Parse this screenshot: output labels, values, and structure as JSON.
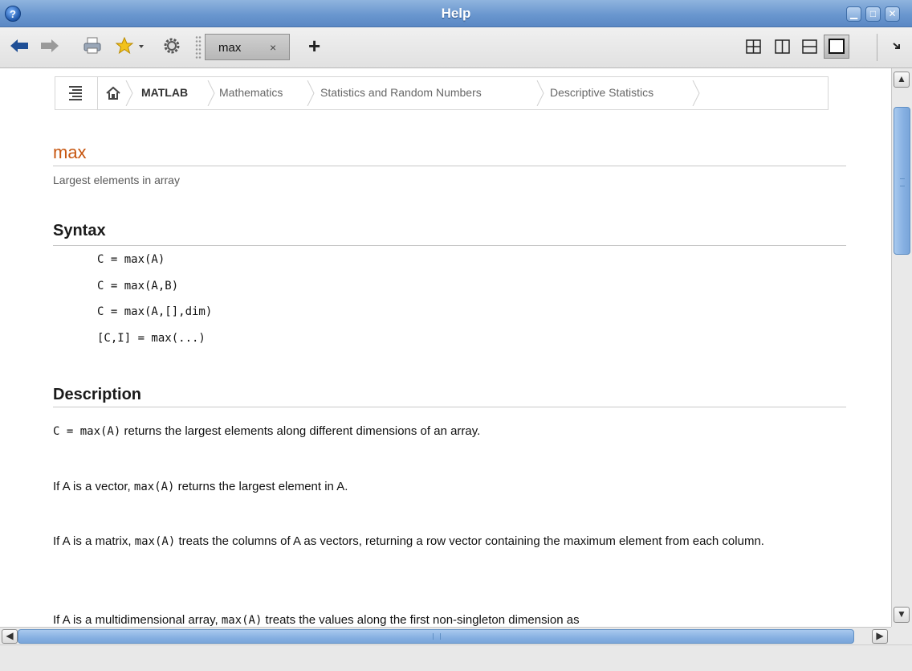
{
  "window": {
    "title": "Help",
    "app_icon": "help-icon",
    "controls": [
      "minimize-icon",
      "maximize-icon",
      "close-icon"
    ]
  },
  "toolbar": {
    "buttons": [
      "back-arrow-icon",
      "forward-arrow-icon",
      "print-icon",
      "favorites-star-icon",
      "settings-gear-icon"
    ],
    "tab": {
      "label": "max",
      "close": "×"
    },
    "add_tab": "+",
    "layout_buttons": [
      "grid-layout-icon",
      "vertical-split-icon",
      "horizontal-split-icon",
      "single-pane-icon"
    ],
    "active_layout": "single-pane-icon"
  },
  "breadcrumb": {
    "items": [
      "MATLAB",
      "Mathematics",
      "Statistics and Random Numbers",
      "Descriptive Statistics"
    ]
  },
  "page": {
    "function_name": "max",
    "purpose": "Largest elements in array",
    "syntax_heading": "Syntax",
    "syntax": [
      "C = max(A)",
      "C = max(A,B)",
      "C = max(A,[],dim)",
      "[C,I] = max(...)"
    ],
    "description_heading": "Description",
    "paragraphs": [
      {
        "code": "C = max(A)",
        "text": " returns the largest elements along different dimensions of an array."
      },
      {
        "pre": "If A is a vector, ",
        "code": "max(A)",
        "text": " returns the largest element in A."
      },
      {
        "pre": "If A is a matrix, ",
        "code": "max(A)",
        "text": " treats the columns of A as vectors, returning a row vector containing the maximum element from each column."
      },
      {
        "pre": "If A is a multidimensional array, ",
        "code": "max(A)",
        "text": " treats the values along the first non-singleton dimension as"
      }
    ]
  },
  "colors": {
    "title_accent": "#c7560f",
    "titlebar": "#6a97cf",
    "scroll_thumb": "#86b0e2"
  }
}
